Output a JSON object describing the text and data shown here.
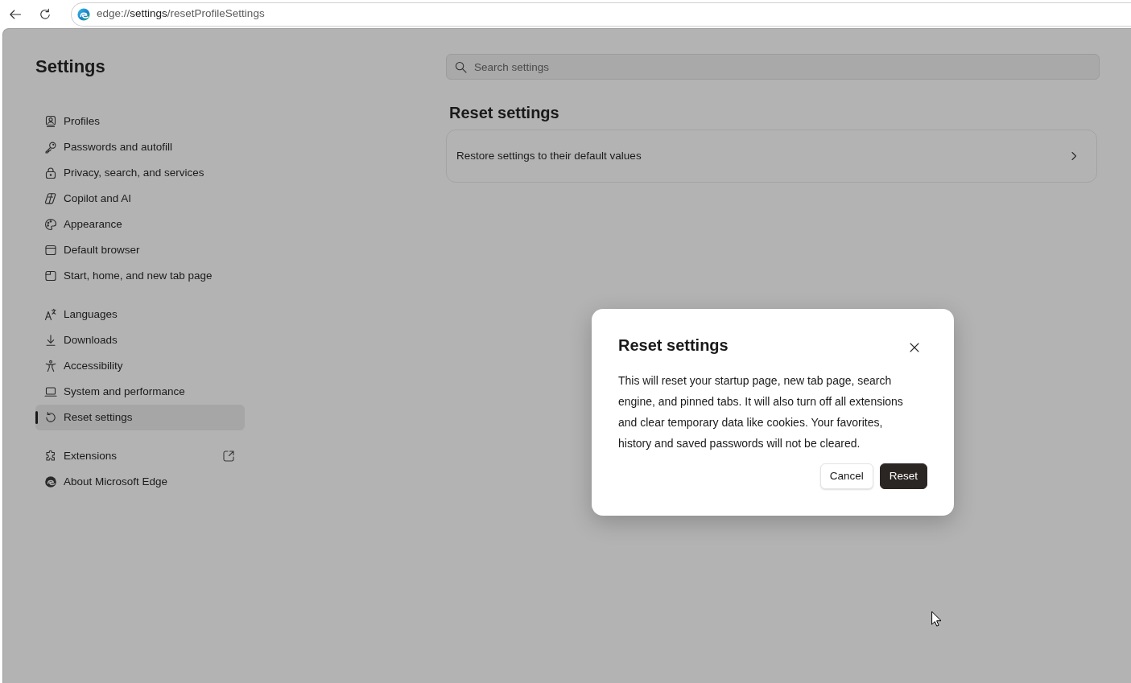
{
  "toolbar": {
    "address": {
      "scheme": "edge://",
      "host": "settings",
      "path": "/resetProfileSettings"
    }
  },
  "sidebar": {
    "title": "Settings",
    "sections": [
      {
        "items": [
          {
            "label": "Profiles",
            "selected": false,
            "external": false
          },
          {
            "label": "Passwords and autofill",
            "selected": false,
            "external": false
          },
          {
            "label": "Privacy, search, and services",
            "selected": false,
            "external": false
          },
          {
            "label": "Copilot and AI",
            "selected": false,
            "external": false
          },
          {
            "label": "Appearance",
            "selected": false,
            "external": false
          },
          {
            "label": "Default browser",
            "selected": false,
            "external": false
          },
          {
            "label": "Start, home, and new tab page",
            "selected": false,
            "external": false
          }
        ]
      },
      {
        "items": [
          {
            "label": "Languages",
            "selected": false,
            "external": false
          },
          {
            "label": "Downloads",
            "selected": false,
            "external": false
          },
          {
            "label": "Accessibility",
            "selected": false,
            "external": false
          },
          {
            "label": "System and performance",
            "selected": false,
            "external": false
          },
          {
            "label": "Reset settings",
            "selected": true,
            "external": false
          }
        ]
      },
      {
        "items": [
          {
            "label": "Extensions",
            "selected": false,
            "external": true
          },
          {
            "label": "About Microsoft Edge",
            "selected": false,
            "external": false
          }
        ]
      }
    ]
  },
  "search": {
    "placeholder": "Search settings"
  },
  "content": {
    "title": "Reset settings",
    "rows": [
      {
        "label": "Restore settings to their default values"
      }
    ]
  },
  "dialog": {
    "title": "Reset settings",
    "body": "This will reset your startup page, new tab page, search engine, and pinned tabs. It will also turn off all extensions and clear temporary data like cookies. Your favorites, history and saved passwords will not be cleared.",
    "buttons": [
      {
        "label": "Cancel",
        "kind": "secondary"
      },
      {
        "label": "Reset",
        "kind": "primary"
      }
    ]
  }
}
